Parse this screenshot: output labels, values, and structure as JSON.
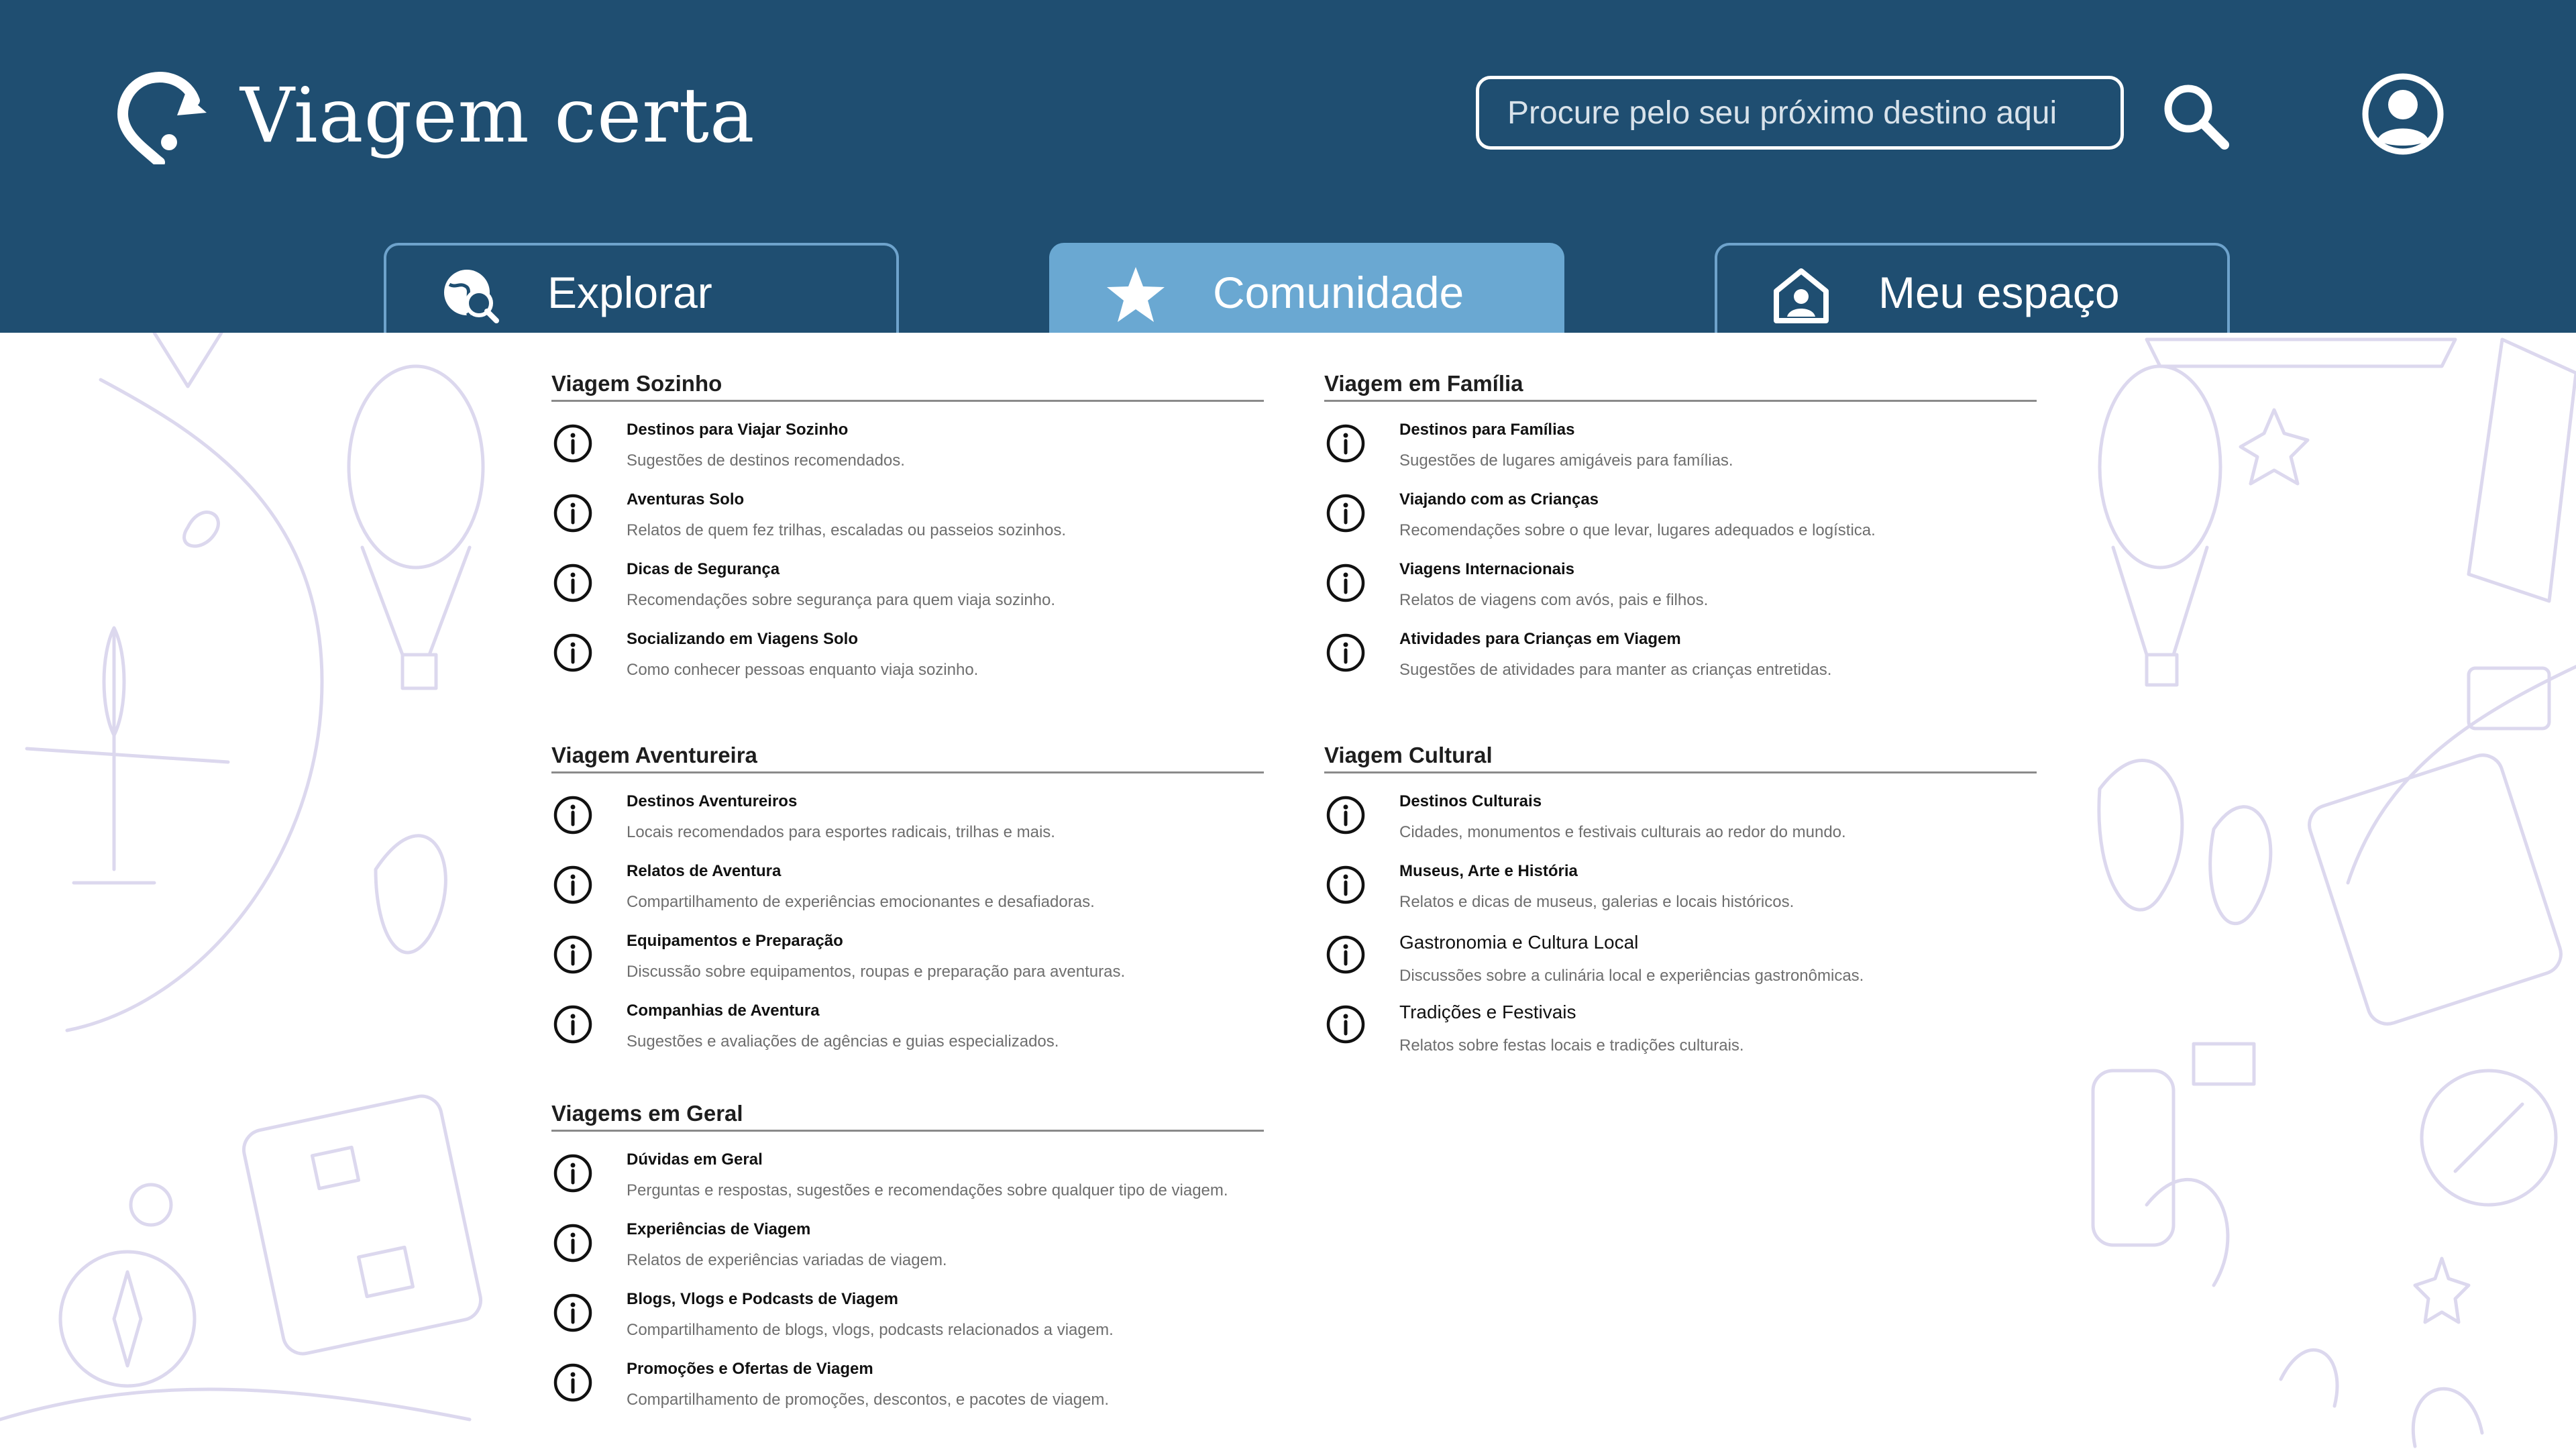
{
  "app": {
    "title": "Viagem certa"
  },
  "search": {
    "placeholder": "Procure pelo seu próximo destino aqui"
  },
  "tabs": [
    {
      "label": "Explorar",
      "icon": "globe-search-icon",
      "active": false
    },
    {
      "label": "Comunidade",
      "icon": "star-icon",
      "active": true
    },
    {
      "label": "Meu espaço",
      "icon": "home-user-icon",
      "active": false
    }
  ],
  "colors": {
    "header": "#1f4e71",
    "active_tab": "#6aa8d2",
    "tab_border": "#6ea3cc",
    "pattern": "#dcd8ee"
  },
  "sections": [
    {
      "title": "Viagem Sozinho",
      "items": [
        {
          "title": "Destinos para Viajar Sozinho",
          "desc": "Sugestões de destinos recomendados."
        },
        {
          "title": "Aventuras Solo",
          "desc": "Relatos de quem fez trilhas, escaladas ou passeios sozinhos."
        },
        {
          "title": "Dicas de Segurança",
          "desc": "Recomendações sobre segurança para quem viaja sozinho."
        },
        {
          "title": "Socializando em Viagens Solo",
          "desc": "Como conhecer pessoas enquanto viaja sozinho."
        }
      ]
    },
    {
      "title": "Viagem em Família",
      "items": [
        {
          "title": "Destinos para Famílias",
          "desc": "Sugestões de lugares amigáveis para famílias."
        },
        {
          "title": "Viajando com as Crianças",
          "desc": "Recomendações sobre o que levar, lugares adequados e logística."
        },
        {
          "title": "Viagens Internacionais",
          "desc": "Relatos de viagens com avós, pais e filhos."
        },
        {
          "title": "Atividades para Crianças em Viagem",
          "desc": "Sugestões de atividades para manter as crianças entretidas."
        }
      ]
    },
    {
      "title": "Viagem Aventureira",
      "items": [
        {
          "title": "Destinos Aventureiros",
          "desc": "Locais recomendados para esportes radicais, trilhas e mais."
        },
        {
          "title": "Relatos de Aventura",
          "desc": "Compartilhamento de experiências emocionantes e desafiadoras."
        },
        {
          "title": "Equipamentos e Preparação",
          "desc": "Discussão sobre equipamentos, roupas e preparação para aventuras."
        },
        {
          "title": "Companhias de Aventura",
          "desc": "Sugestões e avaliações de agências e guias especializados."
        }
      ]
    },
    {
      "title": "Viagem Cultural",
      "items": [
        {
          "title": "Destinos Culturais",
          "desc": "Cidades, monumentos e festivais culturais ao redor do mundo."
        },
        {
          "title": "Museus, Arte e História",
          "desc": "Relatos e dicas de museus, galerias e locais históricos."
        },
        {
          "title": "Gastronomia e Cultura Local",
          "desc": "Discussões sobre a culinária local e experiências gastronômicas."
        },
        {
          "title": "Tradições e Festivais",
          "desc": "Relatos sobre festas locais e tradições culturais."
        }
      ]
    },
    {
      "title": "Viagems em Geral",
      "items": [
        {
          "title": "Dúvidas em Geral",
          "desc": "Perguntas e respostas, sugestões e recomendações sobre qualquer tipo de viagem."
        },
        {
          "title": "Experiências de Viagem",
          "desc": "Relatos de experiências variadas de viagem."
        },
        {
          "title": "Blogs, Vlogs e Podcasts de Viagem",
          "desc": "Compartilhamento de blogs, vlogs, podcasts relacionados a viagem."
        },
        {
          "title": "Promoções e Ofertas de Viagem",
          "desc": "Compartilhamento de promoções, descontos, e pacotes de viagem."
        }
      ]
    }
  ]
}
